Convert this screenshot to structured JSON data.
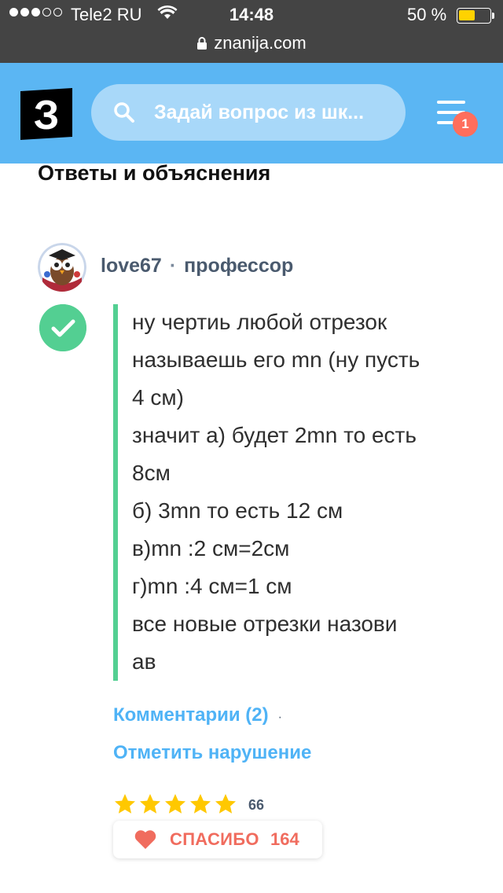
{
  "status_bar": {
    "carrier": "Tele2 RU",
    "time": "14:48",
    "battery_percent": "50 %",
    "url": "znanija.com",
    "signal_dots_filled": 3,
    "signal_dots_total": 5
  },
  "header": {
    "logo_letter": "З",
    "search_placeholder": "Задай вопрос из шк...",
    "menu_badge": "1",
    "colors": {
      "bar": "#5bb6f3",
      "badge": "#ff6e5c"
    }
  },
  "content": {
    "section_title": "Ответы и объяснения",
    "answer": {
      "author": "love67",
      "separator": "·",
      "rank": "профессор",
      "lines": [
        "ну чертиь любой отрезок",
        "называешь его mn (ну пусть",
        "4 см)",
        "значит а) будет 2mn то есть",
        "8см",
        "б) 3mn то есть 12 см",
        "в)mn :2 см=2см",
        "г)mn :4 см=1 см",
        "все новые отрезки назови",
        "ав"
      ],
      "comments_link": "Комментарии (2)",
      "report_link": "Отметить нарушение",
      "rating_stars": 5,
      "rating_count": "66",
      "thanks_label": "СПАСИБО",
      "thanks_count": "164"
    },
    "colors": {
      "accent_green": "#53cf92",
      "link_blue": "#4fb3f6",
      "star_yellow": "#ffc800",
      "thanks_red": "#f06c5e"
    }
  }
}
